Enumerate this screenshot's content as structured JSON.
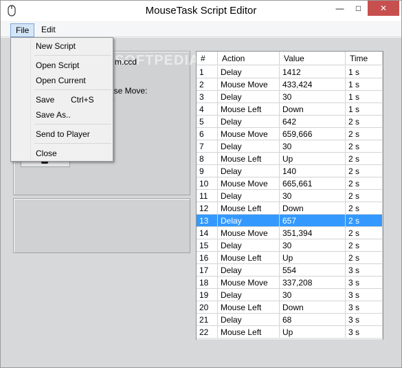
{
  "window": {
    "title": "MouseTask Script Editor",
    "controls": {
      "minimize": "—",
      "maximize": "□",
      "close": "✕"
    }
  },
  "menubar": {
    "items": [
      {
        "label": "File"
      },
      {
        "label": "Edit"
      }
    ]
  },
  "file_menu": {
    "items": [
      {
        "label": "New Script"
      },
      {
        "label": "Open Script"
      },
      {
        "label": "Open Current"
      },
      {
        "label": "Save",
        "shortcut": "Ctrl+S"
      },
      {
        "label": "Save As.."
      },
      {
        "label": "Send to Player"
      },
      {
        "label": "Close"
      }
    ]
  },
  "left_panel": {
    "filename_fragment": "m.ccd",
    "watermark": "SOFTPEDIA",
    "info_line_1": "use Move:",
    "info_line_2": "4"
  },
  "table": {
    "columns": [
      "#",
      "Action",
      "Value",
      "Time"
    ],
    "selected_row_index": 12,
    "rows": [
      {
        "num": "1",
        "action": "Delay",
        "value": "1412",
        "time": "1 s"
      },
      {
        "num": "2",
        "action": "Mouse Move",
        "value": "433,424",
        "time": "1 s"
      },
      {
        "num": "3",
        "action": "Delay",
        "value": "30",
        "time": "1 s"
      },
      {
        "num": "4",
        "action": "Mouse Left",
        "value": "Down",
        "time": "1 s"
      },
      {
        "num": "5",
        "action": "Delay",
        "value": "642",
        "time": "2 s"
      },
      {
        "num": "6",
        "action": "Mouse Move",
        "value": "659,666",
        "time": "2 s"
      },
      {
        "num": "7",
        "action": "Delay",
        "value": "30",
        "time": "2 s"
      },
      {
        "num": "8",
        "action": "Mouse Left",
        "value": "Up",
        "time": "2 s"
      },
      {
        "num": "9",
        "action": "Delay",
        "value": "140",
        "time": "2 s"
      },
      {
        "num": "10",
        "action": "Mouse Move",
        "value": "665,661",
        "time": "2 s"
      },
      {
        "num": "11",
        "action": "Delay",
        "value": "30",
        "time": "2 s"
      },
      {
        "num": "12",
        "action": "Mouse Left",
        "value": "Down",
        "time": "2 s"
      },
      {
        "num": "13",
        "action": "Delay",
        "value": "657",
        "time": "2 s"
      },
      {
        "num": "14",
        "action": "Mouse Move",
        "value": "351,394",
        "time": "2 s"
      },
      {
        "num": "15",
        "action": "Delay",
        "value": "30",
        "time": "2 s"
      },
      {
        "num": "16",
        "action": "Mouse Left",
        "value": "Up",
        "time": "2 s"
      },
      {
        "num": "17",
        "action": "Delay",
        "value": "554",
        "time": "3 s"
      },
      {
        "num": "18",
        "action": "Mouse Move",
        "value": "337,208",
        "time": "3 s"
      },
      {
        "num": "19",
        "action": "Delay",
        "value": "30",
        "time": "3 s"
      },
      {
        "num": "20",
        "action": "Mouse Left",
        "value": "Down",
        "time": "3 s"
      },
      {
        "num": "21",
        "action": "Delay",
        "value": "68",
        "time": "3 s"
      },
      {
        "num": "22",
        "action": "Mouse Left",
        "value": "Up",
        "time": "3 s"
      }
    ]
  },
  "colors": {
    "selection": "#3399ff",
    "close_button": "#c7504f",
    "client_background": "#d6d8d9"
  }
}
